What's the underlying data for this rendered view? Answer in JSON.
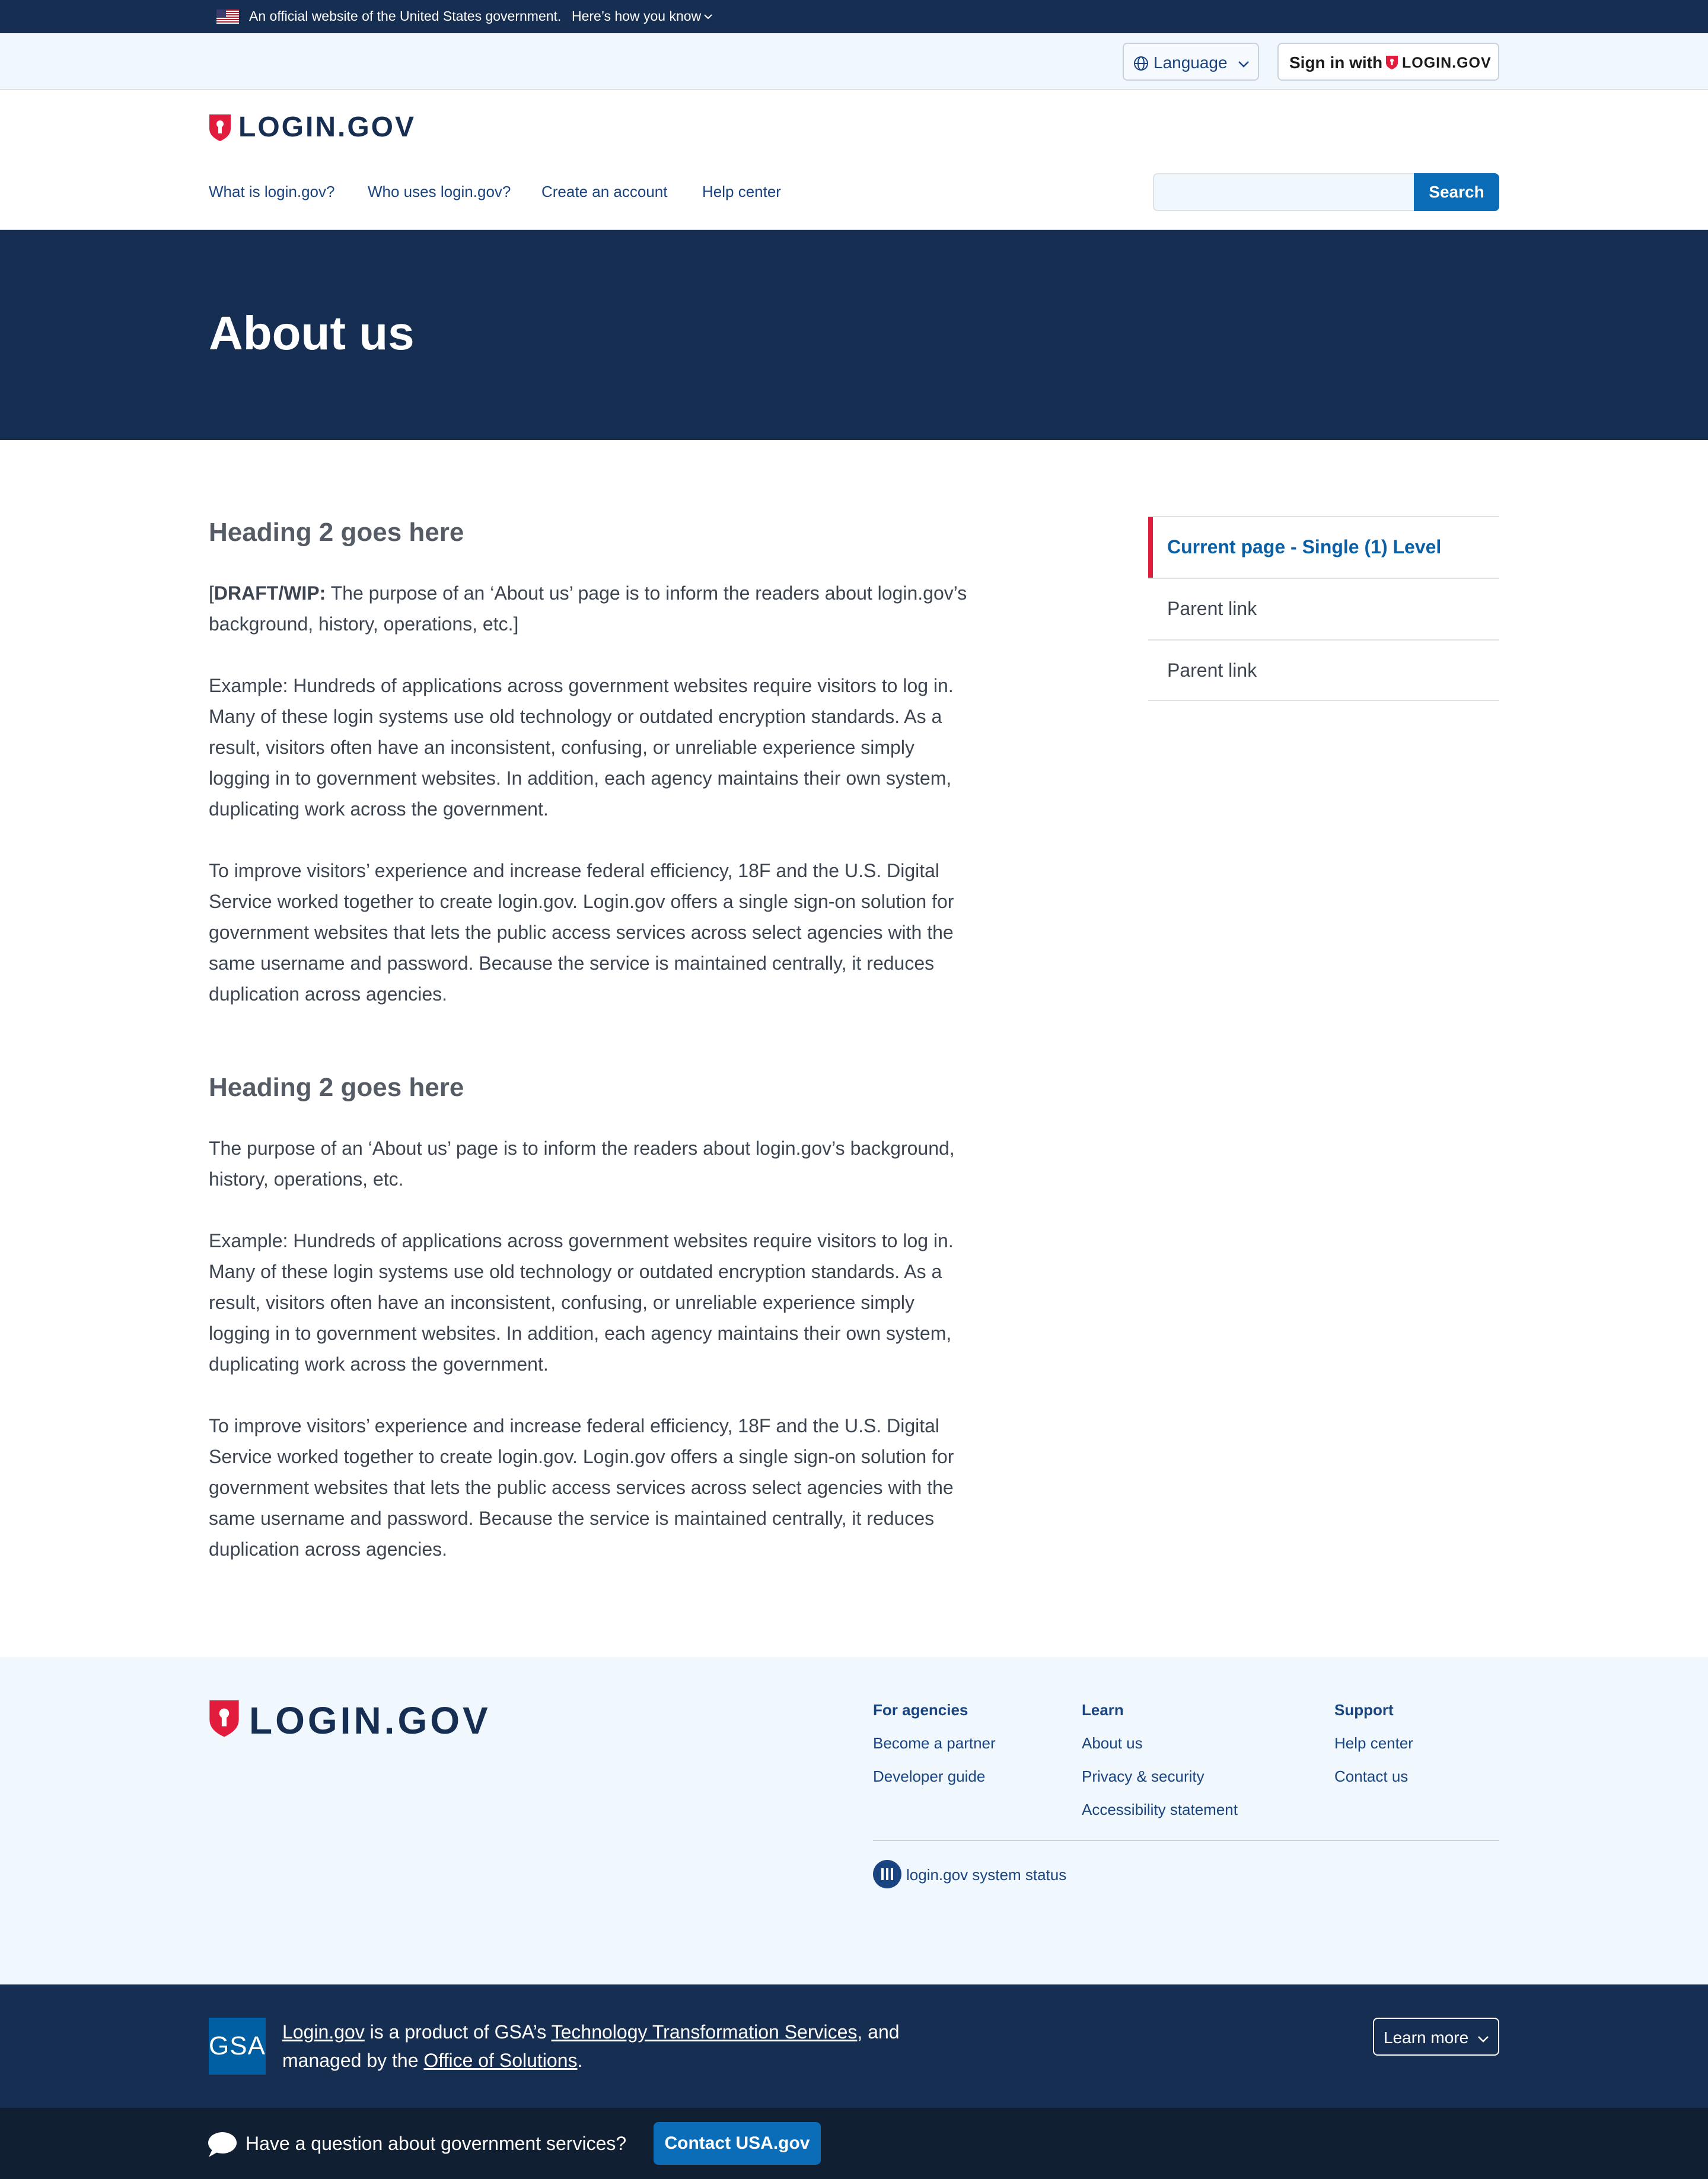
{
  "gov_banner": {
    "text": "An official website of the United States government.",
    "link": "Here’s how you know"
  },
  "utility": {
    "language_label": "Language",
    "signin_label": "Sign in with",
    "signin_brand": "LOGIN.GOV"
  },
  "header": {
    "logo_text": "LOGIN.GOV",
    "nav": [
      "What is login.gov?",
      "Who uses login.gov?",
      "Create an account",
      "Help center"
    ],
    "search": {
      "placeholder": "",
      "button_label": "Search"
    }
  },
  "hero": {
    "title": "About us"
  },
  "main": {
    "sections": [
      {
        "heading": "Heading 2 goes here",
        "draft_label": "DRAFT/WIP:",
        "intro": "The purpose of an ‘About us’ page is to inform the readers about login.gov’s background, history, operations, etc.]",
        "p2": "Example: Hundreds of applications across government websites require visitors to log in. Many of these login systems use old technology or outdated encryption standards. As a result, visitors often have an inconsistent, confusing, or unreliable experience simply logging in to government websites. In addition, each agency maintains their own system, duplicating work across the government.",
        "p3": "To improve visitors’ experience and increase federal efficiency, 18F and the U.S. Digital Service worked together to create login.gov. Login.gov offers a single sign-on solution for government websites that lets the public access services across select agencies with the same username and password. Because the service is maintained centrally, it reduces duplication across agencies."
      },
      {
        "heading": "Heading 2 goes here",
        "intro": "The purpose of an ‘About us’ page is to inform the readers about login.gov’s background, history, operations, etc.",
        "p2": "Example: Hundreds of applications across government websites require visitors to log in. Many of these login systems use old technology or outdated encryption standards. As a result, visitors often have an inconsistent, confusing, or unreliable experience simply logging in to government websites. In addition, each agency maintains their own system, duplicating work across the government.",
        "p3": "To improve visitors’ experience and increase federal efficiency, 18F and the U.S. Digital Service worked together to create login.gov. Login.gov offers a single sign-on solution for government websites that lets the public access services across select agencies with the same username and password. Because the service is maintained centrally, it reduces duplication across agencies."
      }
    ]
  },
  "sidenav": {
    "items": [
      {
        "label": "Current page - Single (1) Level",
        "current": true
      },
      {
        "label": "Parent link",
        "current": false
      },
      {
        "label": "Parent link",
        "current": false
      }
    ]
  },
  "footer": {
    "logo_text": "LOGIN.GOV",
    "columns": [
      {
        "heading": "For agencies",
        "links": [
          "Become a partner",
          "Developer guide"
        ]
      },
      {
        "heading": "Learn",
        "links": [
          "About us",
          "Privacy & security",
          "Accessibility statement"
        ]
      },
      {
        "heading": "Support",
        "links": [
          "Help center",
          "Contact us"
        ]
      }
    ],
    "status_label": "login.gov system status"
  },
  "identifier": {
    "gsa_logo_text": "GSA",
    "link_logingov": "Login.gov",
    "text_1": " is a product of GSA’s ",
    "link_tts": "Technology Transformation Services",
    "text_2": ", and managed by the ",
    "link_solutions": "Office of Solutions",
    "text_3": ".",
    "learn_more_label": "Learn more"
  },
  "usa_bar": {
    "question": "Have a question about government services?",
    "button_label": "Contact USA.gov"
  },
  "colors": {
    "navy": "#162e51",
    "link_blue": "#1a4480",
    "primary_blue": "#0b6cb8",
    "brand_red": "#e21c3d",
    "light_bg": "#f0f7fd"
  }
}
